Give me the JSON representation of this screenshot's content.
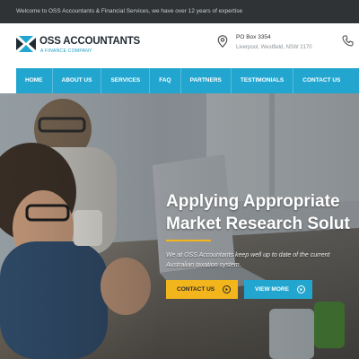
{
  "topbar": {
    "welcome_text": "Welcome to OSS Accountants & Financial Services, we have over 12 years of expertise"
  },
  "brand": {
    "name": "OSS ACCOUNTANTS",
    "tagline": "A FINANCE COMPANY",
    "colors": {
      "accent": "#22a6cf",
      "highlight": "#f2b51c",
      "dark": "#2f3336"
    }
  },
  "contact": {
    "address_line1": "PO Box 3354",
    "address_line2": "Liverpool, Westfield, NSW 2170",
    "location_icon": "map-pin-icon",
    "phone_icon": "phone-icon"
  },
  "nav": {
    "items": [
      {
        "label": "HOME"
      },
      {
        "label": "ABOUT US"
      },
      {
        "label": "SERVICES"
      },
      {
        "label": "FAQ"
      },
      {
        "label": "PARTNERS"
      },
      {
        "label": "TESTIMONIALS"
      },
      {
        "label": "CONTACT US"
      }
    ]
  },
  "hero": {
    "headline_line1": "Applying Appropriate",
    "headline_line2": "Market Research Solut",
    "description": "We at OSS Accountants keep well up to date of the current Australian taxation system.",
    "contact_button": "CONTACT US",
    "more_button": "VIEW MORE"
  }
}
